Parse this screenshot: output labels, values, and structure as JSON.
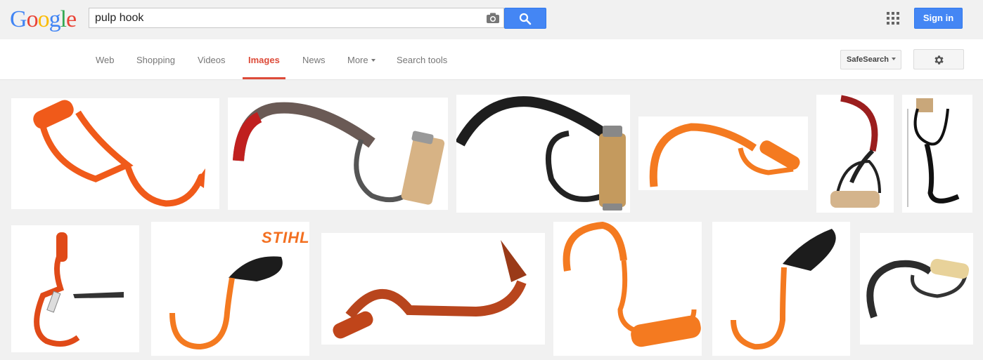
{
  "header": {
    "logo_letters": [
      "G",
      "o",
      "o",
      "g",
      "l",
      "e"
    ],
    "logo_colors": [
      "#4285f4",
      "#ea4335",
      "#fbbc05",
      "#4285f4",
      "#34a853",
      "#ea4335"
    ],
    "query": "pulp hook",
    "camera_icon": "camera-icon",
    "search_icon": "search-icon",
    "apps_icon": "apps-grid-icon",
    "signin_label": "Sign in"
  },
  "nav": {
    "tabs": [
      "Web",
      "Shopping",
      "Videos",
      "Images",
      "News",
      "More",
      "Search tools"
    ],
    "active_tab": "Images",
    "safesearch_label": "SafeSearch",
    "settings_icon": "gear-icon"
  },
  "results": {
    "brand_text": "STIHL",
    "accent_color": "#dd4b39",
    "button_color": "#4486f4"
  }
}
